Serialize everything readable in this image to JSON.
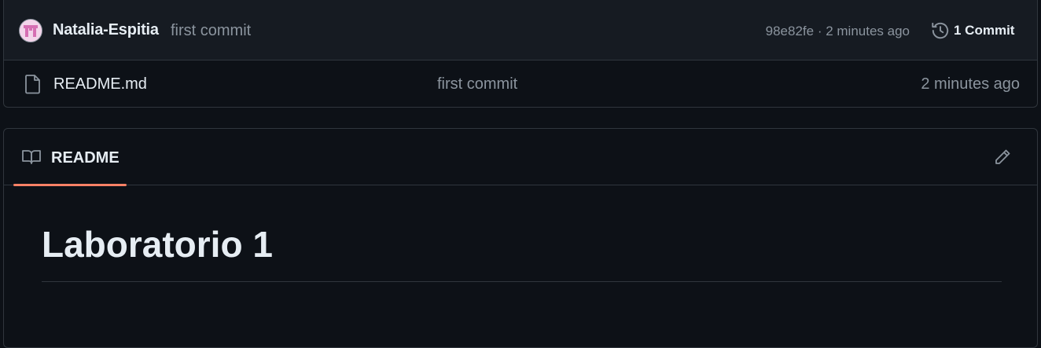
{
  "commit_bar": {
    "author": "Natalia-Espitia",
    "message": "first commit",
    "meta": "98e82fe · 2 minutes ago",
    "commit_count": "1 Commit"
  },
  "files": [
    {
      "name": "README.md",
      "message": "first commit",
      "time": "2 minutes ago"
    }
  ],
  "readme": {
    "tab_label": "README",
    "title": "Laboratorio 1"
  },
  "colors": {
    "background": "#0d1117",
    "header_bg": "#161b22",
    "border": "#30363d",
    "text": "#e6edf3",
    "muted": "#8b949e",
    "accent": "#f78166"
  },
  "icons": [
    "avatar",
    "history-icon",
    "file-icon",
    "book-icon",
    "pencil-icon"
  ]
}
